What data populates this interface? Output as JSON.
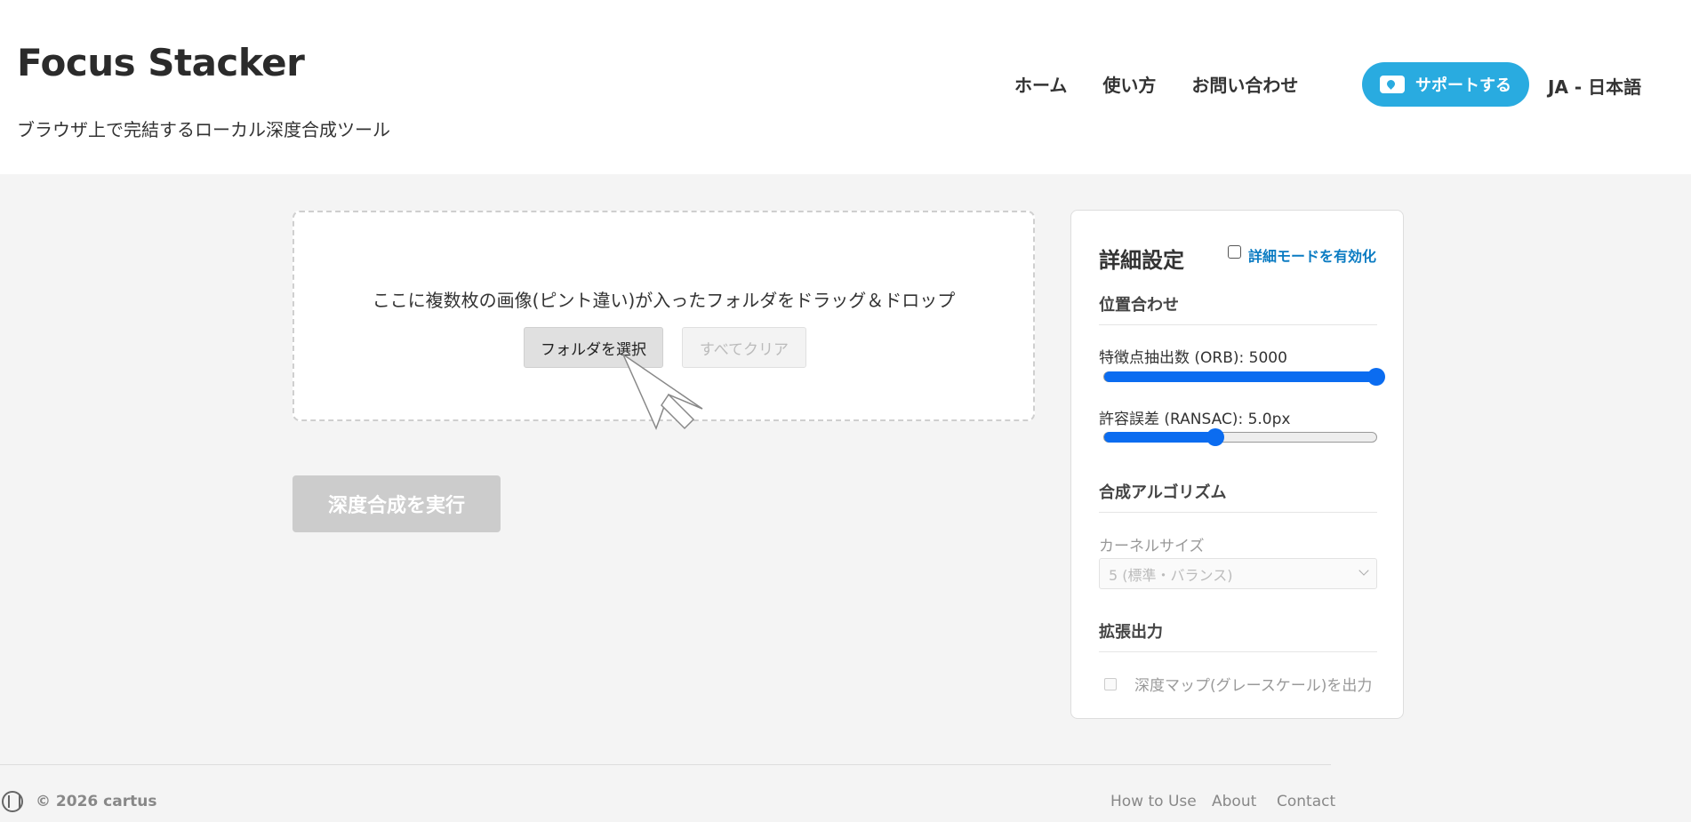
{
  "header": {
    "title": "Focus Stacker",
    "subtitle": "ブラウザ上で完結するローカル深度合成ツール",
    "nav": [
      "ホーム",
      "使い方",
      "お問い合わせ"
    ],
    "support_label": "サポートする",
    "language": "JA - 日本語",
    "support_color": "#29abe0"
  },
  "dropzone": {
    "instruction": "ここに複数枚の画像(ピント違い)が入ったフォルダをドラッグ＆ドロップ",
    "select_folder": "フォルダを選択",
    "clear_all": "すべてクリア"
  },
  "run_button": "深度合成を実行",
  "settings": {
    "title": "詳細設定",
    "advanced_toggle": "詳細モードを有効化",
    "advanced_enabled": false,
    "alignment_section": "位置合わせ",
    "orb_label": "特徴点抽出数 (ORB): 5000",
    "orb_fraction": 1.0,
    "ransac_label": "許容誤差 (RANSAC): 5.0px",
    "ransac_fraction": 0.41,
    "algorithm_section": "合成アルゴリズム",
    "kernel_label": "カーネルサイズ",
    "kernel_value": "5 (標準・バランス)",
    "extended_section": "拡張出力",
    "depth_map_label": "深度マップ(グレースケール)を出力",
    "depth_map_checked": false,
    "accent_color": "#0b6cf0"
  },
  "footer": {
    "copyright": "© 2026 cartus",
    "links": [
      "How to Use",
      "About",
      "Contact"
    ]
  }
}
